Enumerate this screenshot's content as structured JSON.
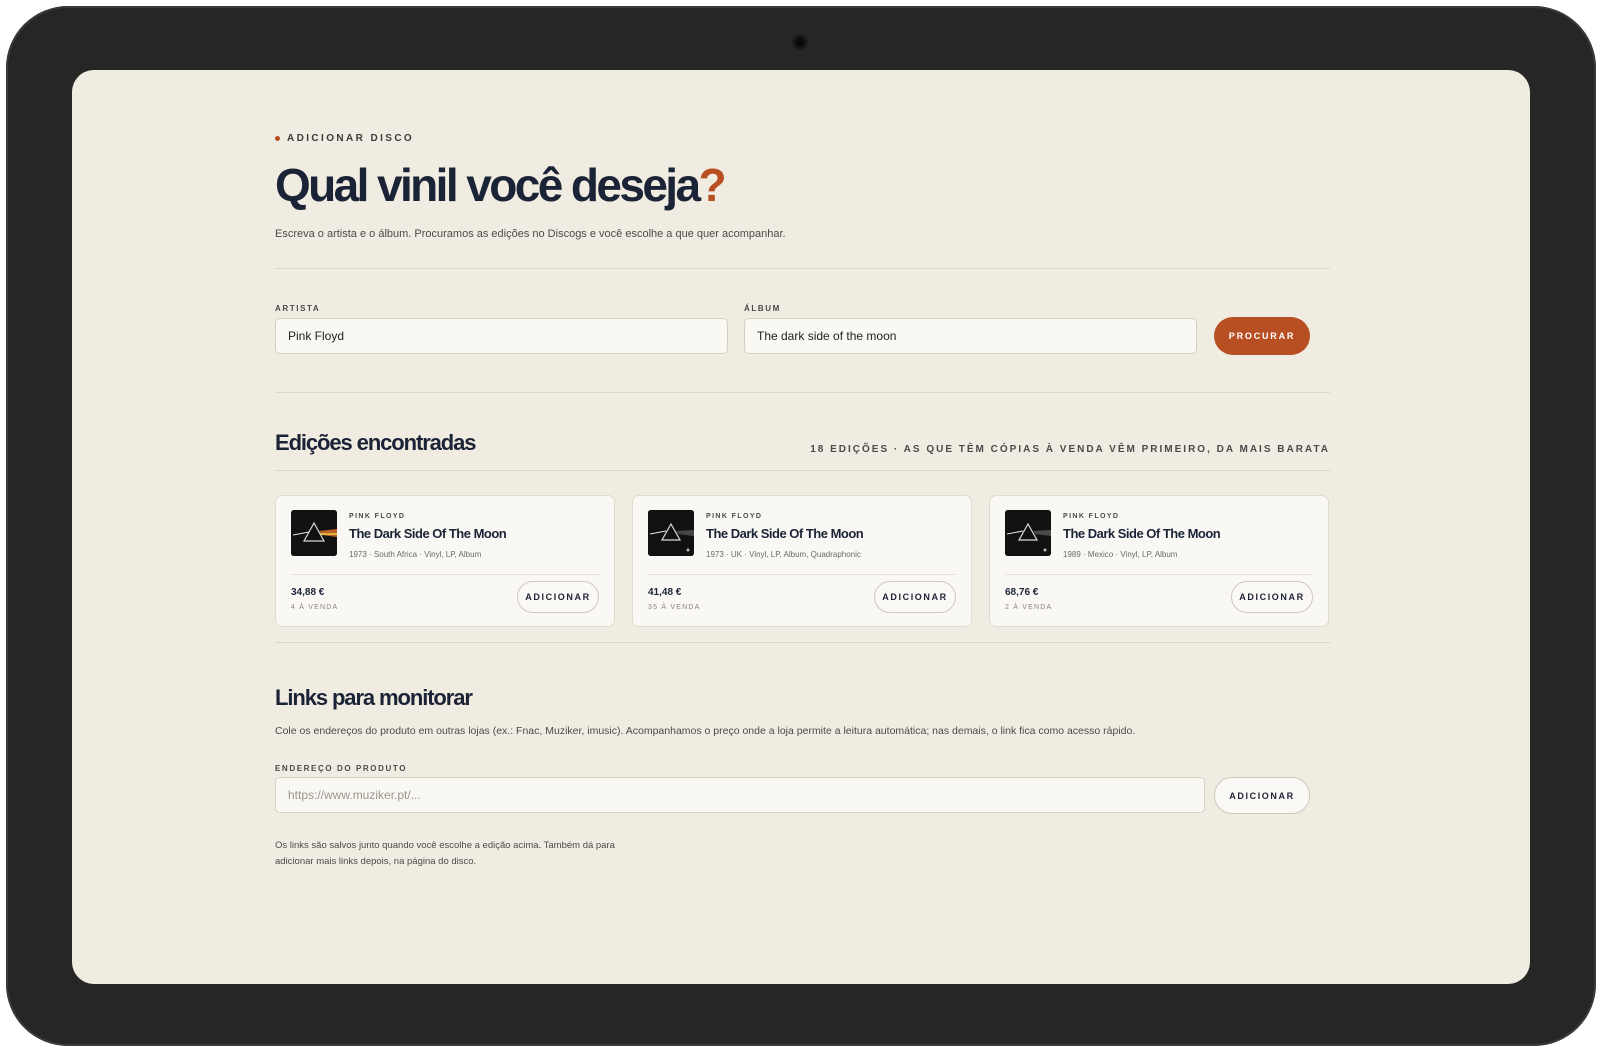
{
  "header": {
    "eyebrow": "ADICIONAR DISCO",
    "headline_main": "Qual vinil você deseja",
    "headline_mark": "?",
    "subtitle": "Escreva o artista e o álbum. Procuramos as edições no Discogs e você escolhe a que quer acompanhar."
  },
  "search": {
    "artist_label": "ARTISTA",
    "artist_value": "Pink Floyd",
    "album_label": "ÁLBUM",
    "album_value": "The dark side of the moon",
    "search_button": "PROCURAR"
  },
  "results": {
    "title": "Edições encontradas",
    "meta": "18 EDIÇÕES · AS QUE TÊM CÓPIAS À VENDA VÊM PRIMEIRO, DA MAIS BARATA",
    "editions": [
      {
        "artist": "PINK FLOYD",
        "title": "The Dark Side Of The Moon",
        "details": "1973 · South Africa · Vinyl, LP, Album",
        "price": "34,88 €",
        "stock": "4 À VENDA",
        "button": "ADICIONAR"
      },
      {
        "artist": "PINK FLOYD",
        "title": "The Dark Side Of The Moon",
        "details": "1973 · UK · Vinyl, LP, Album, Quadraphonic",
        "price": "41,48 €",
        "stock": "35 À VENDA",
        "button": "ADICIONAR"
      },
      {
        "artist": "PINK FLOYD",
        "title": "The Dark Side Of The Moon",
        "details": "1989 · Mexico · Vinyl, LP, Album",
        "price": "68,76 €",
        "stock": "2 À VENDA",
        "button": "ADICIONAR"
      }
    ]
  },
  "links": {
    "title": "Links para monitorar",
    "description": "Cole os endereços do produto em outras lojas (ex.: Fnac, Muziker, imusic). Acompanhamos o preço onde a loja permite a leitura automática; nas demais, o link fica como acesso rápido.",
    "url_label": "ENDEREÇO DO PRODUTO",
    "url_placeholder": "https://www.muziker.pt/...",
    "add_button": "ADICIONAR",
    "footnote": "Os links são salvos junto quando você escolhe a edição acima. Também dá para adicionar mais links depois, na página do disco."
  },
  "colors": {
    "accent": "#b84f22",
    "ink": "#1b2336",
    "background": "#f1ece1",
    "device_frame": "#262626"
  },
  "icons": {
    "camera": "camera-icon",
    "cover_art": "prism-album-cover"
  }
}
